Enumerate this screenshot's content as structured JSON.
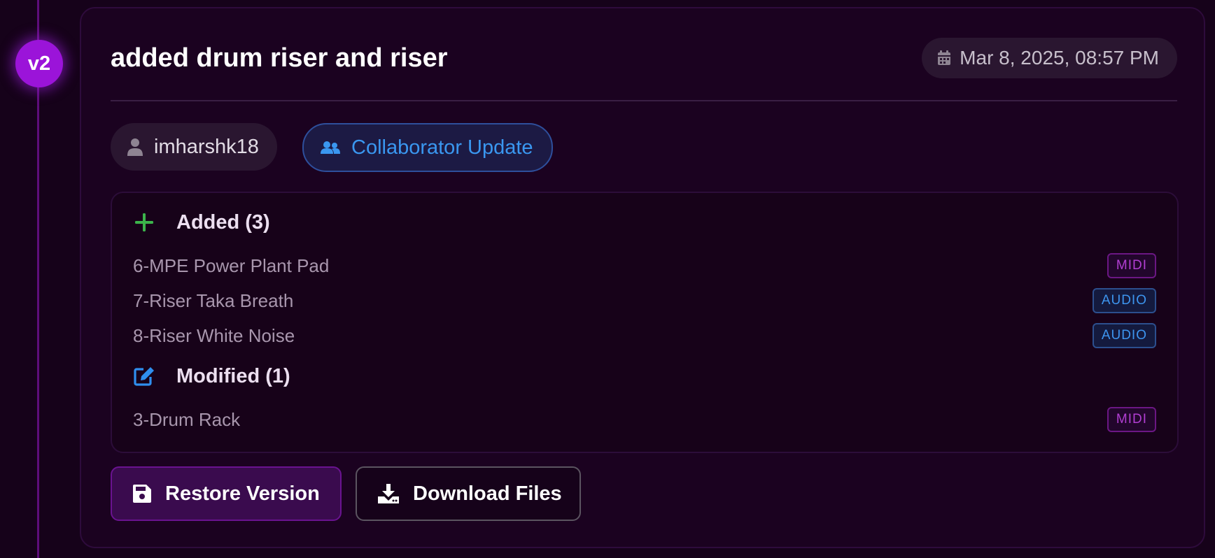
{
  "version": {
    "badge": "v2"
  },
  "card": {
    "title": "added drum riser and riser",
    "timestamp": "Mar 8, 2025, 08:57 PM",
    "author": "imharshk18",
    "update_type": "Collaborator Update"
  },
  "changes": {
    "added": {
      "heading": "Added (3)",
      "items": [
        {
          "name": "6-MPE Power Plant Pad",
          "type": "MIDI"
        },
        {
          "name": "7-Riser Taka Breath",
          "type": "AUDIO"
        },
        {
          "name": "8-Riser White Noise",
          "type": "AUDIO"
        }
      ]
    },
    "modified": {
      "heading": "Modified (1)",
      "items": [
        {
          "name": "3-Drum Rack",
          "type": "MIDI"
        }
      ]
    }
  },
  "actions": {
    "restore_label": "Restore Version",
    "download_label": "Download Files"
  },
  "colors": {
    "accent_purple": "#9b14d9",
    "added_green": "#3cb44b",
    "modified_blue": "#2f8fee",
    "midi_tag": "#b13ed2",
    "audio_tag": "#3d95ef"
  },
  "icons": {
    "date": "calendar-icon",
    "author": "user-icon",
    "collaborator": "users-icon",
    "added": "plus-icon",
    "modified": "edit-icon",
    "restore": "save-icon",
    "download": "download-icon"
  }
}
